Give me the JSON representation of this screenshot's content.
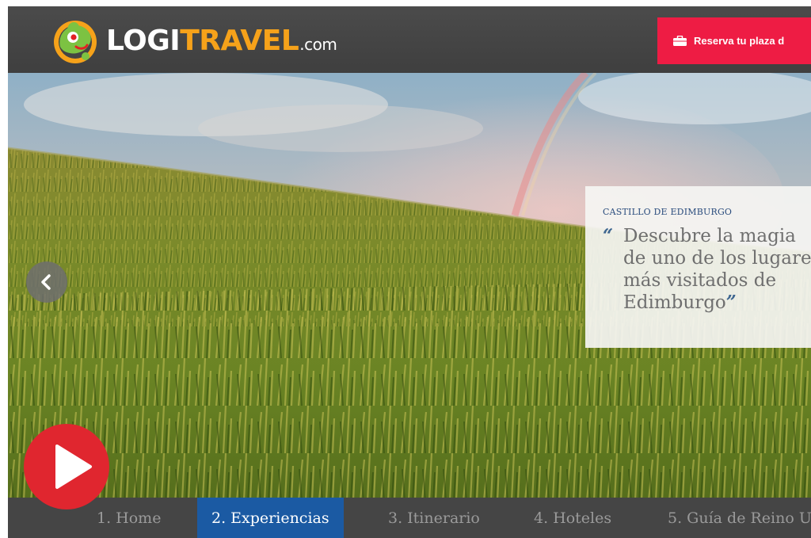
{
  "header": {
    "logo": {
      "part1": "LOGI",
      "part2": "TRAVEL",
      "part3": ".com"
    },
    "cta_label": "Reserva tu plaza d"
  },
  "hero": {
    "kicker": "CASTILLO DE EDIMBURGO",
    "quote": "Descubre la magia de uno de los lugares más visitados de Edimburgo",
    "quote_lines": [
      "Descubre la magia",
      "de uno de los lugare",
      "más visitados de",
      "Edimburgo"
    ]
  },
  "nav": {
    "items": [
      {
        "label": "1. Home"
      },
      {
        "label": "2. Experiencias"
      },
      {
        "label": "3. Itinerario"
      },
      {
        "label": "4. Hoteles"
      },
      {
        "label": "5. Guía de Reino U"
      }
    ]
  },
  "icons": {
    "prev": "chevron-left-icon",
    "play": "play-icon",
    "bag": "briefcase-icon"
  },
  "colors": {
    "header_bg": "#444444",
    "cta": "#ee1c44",
    "nav_active": "#1b5aa3",
    "logo_accent": "#f6a21a",
    "play": "#e0262f"
  }
}
